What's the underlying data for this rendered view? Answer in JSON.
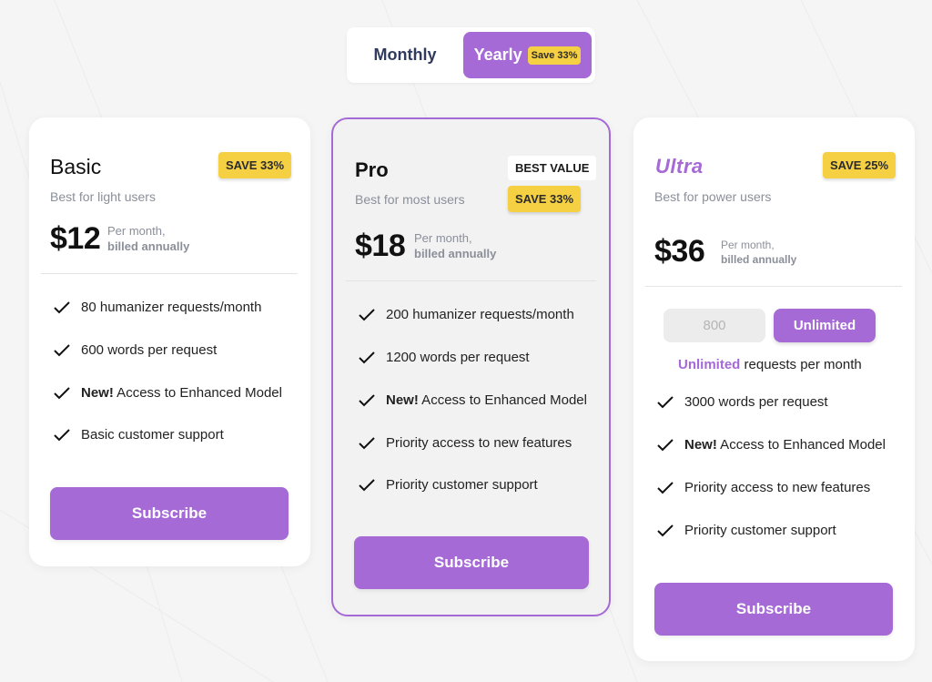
{
  "colors": {
    "accent": "#a56ad6",
    "badge_yellow": "#f5d042",
    "muted_text": "#8a8f99",
    "background": "#f5f5f5"
  },
  "toggle": {
    "monthly_label": "Monthly",
    "yearly_label": "Yearly",
    "yearly_badge": "Save 33%",
    "selected": "Yearly"
  },
  "plans": {
    "basic": {
      "name": "Basic",
      "badge": "SAVE 33%",
      "subtitle": "Best for light users",
      "price": "$12",
      "price_note_1": "Per month,",
      "price_note_2": "billed annually",
      "features": [
        {
          "bold": "",
          "text": "80 humanizer requests/month"
        },
        {
          "bold": "",
          "text": "600 words per request"
        },
        {
          "bold": "New!",
          "text": " Access to Enhanced Model"
        },
        {
          "bold": "",
          "text": "Basic customer support"
        }
      ],
      "cta": "Subscribe"
    },
    "pro": {
      "name": "Pro",
      "best_badge": "BEST VALUE",
      "badge": "SAVE 33%",
      "subtitle": "Best for most users",
      "price": "$18",
      "price_note_1": "Per month,",
      "price_note_2": "billed annually",
      "features": [
        {
          "bold": "",
          "text": "200 humanizer requests/month"
        },
        {
          "bold": "",
          "text": "1200 words per request"
        },
        {
          "bold": "New!",
          "text": " Access to Enhanced Model"
        },
        {
          "bold": "",
          "text": "Priority access to new features"
        },
        {
          "bold": "",
          "text": "Priority customer support"
        }
      ],
      "cta": "Subscribe"
    },
    "ultra": {
      "name": "Ultra",
      "badge": "SAVE 25%",
      "subtitle": "Best for power users",
      "price": "$36",
      "price_note_1": "Per month,",
      "price_note_2": "billed annually",
      "requests_options": [
        "800",
        "Unlimited"
      ],
      "requests_selected": "Unlimited",
      "requests_accent": "Unlimited",
      "requests_text": " requests per month",
      "features": [
        {
          "bold": "",
          "text": "3000 words per request"
        },
        {
          "bold": "New!",
          "text": " Access to Enhanced Model"
        },
        {
          "bold": "",
          "text": "Priority access to new features"
        },
        {
          "bold": "",
          "text": "Priority customer support"
        }
      ],
      "cta": "Subscribe"
    }
  }
}
